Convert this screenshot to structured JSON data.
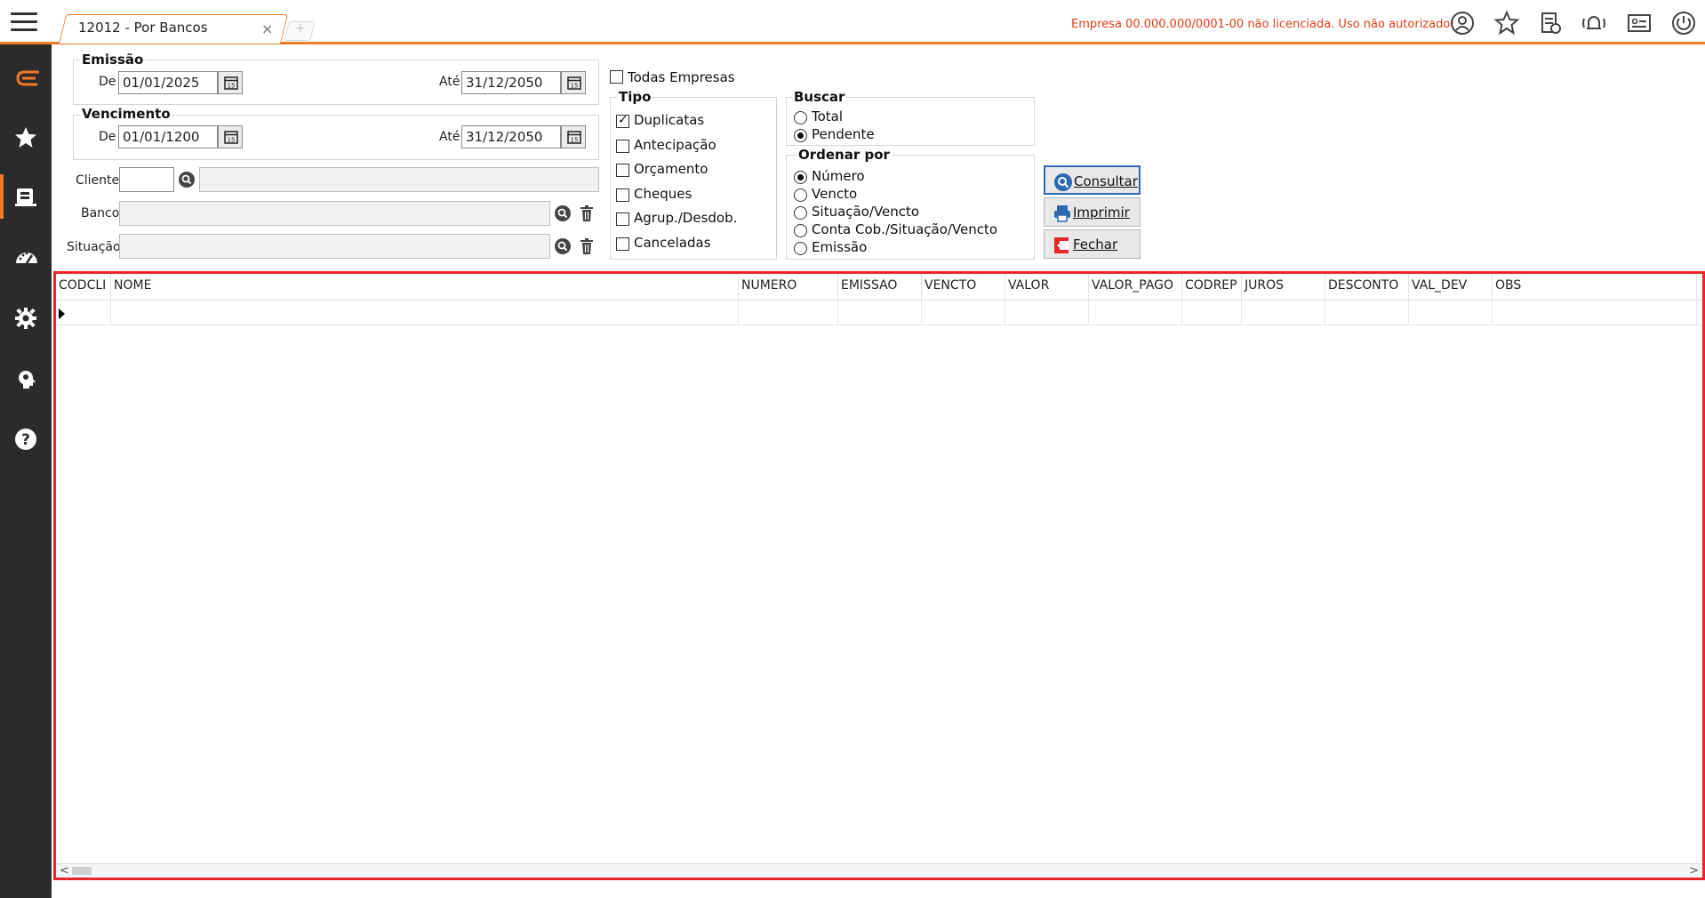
{
  "tab": {
    "label": "12012 - Por Bancos",
    "close": "×",
    "new": "+"
  },
  "license_warning": "Empresa 00.000.000/0001-00 não licenciada. Uso não autorizado!",
  "icons": {
    "top": [
      "user-icon",
      "star-icon",
      "report-icon",
      "notification-icon",
      "id-card-icon",
      "power-icon"
    ],
    "sidebar": [
      "logo-icon",
      "star-icon",
      "reports-icon",
      "dashboard-icon",
      "settings-icon",
      "brain-gear-icon",
      "help-icon"
    ]
  },
  "colors": {
    "accent": "#f07a28",
    "sidebar": "#2b2b2b",
    "warning": "#e23c17",
    "grid_border": "#e5262b",
    "focus": "#2c6bb2"
  },
  "emissao": {
    "title": "Emissão",
    "de_label": "De",
    "de_value": "01/01/2025",
    "ate_label": "Até",
    "ate_value": "31/12/2050"
  },
  "vencimento": {
    "title": "Vencimento",
    "de_label": "De",
    "de_value": "01/01/1200",
    "ate_label": "Até",
    "ate_value": "31/12/2050"
  },
  "cliente": {
    "label": "Cliente",
    "code": "",
    "name": ""
  },
  "banco": {
    "label": "Banco",
    "value": ""
  },
  "situacao": {
    "label": "Situação",
    "value": ""
  },
  "todas_empresas": {
    "label": "Todas Empresas",
    "checked": false
  },
  "tipo": {
    "title": "Tipo",
    "items": [
      {
        "label": "Duplicatas",
        "checked": true
      },
      {
        "label": "Antecipação",
        "checked": false
      },
      {
        "label": "Orçamento",
        "checked": false
      },
      {
        "label": "Cheques",
        "checked": false
      },
      {
        "label": "Agrup./Desdob.",
        "checked": false
      },
      {
        "label": "Canceladas",
        "checked": false
      }
    ]
  },
  "buscar": {
    "title": "Buscar",
    "items": [
      {
        "label": "Total",
        "checked": false
      },
      {
        "label": "Pendente",
        "checked": true
      }
    ]
  },
  "ordenar": {
    "title": "Ordenar por",
    "items": [
      {
        "label": "Número",
        "checked": true
      },
      {
        "label": "Vencto",
        "checked": false
      },
      {
        "label": "Situação/Vencto",
        "checked": false
      },
      {
        "label": "Conta Cob./Situação/Vencto",
        "checked": false
      },
      {
        "label": "Emissão",
        "checked": false
      }
    ]
  },
  "buttons": {
    "consultar": "Consultar",
    "imprimir": "Imprimir",
    "fechar": "Fechar"
  },
  "grid": {
    "columns": [
      "CODCLI",
      "NOME",
      "NUMERO",
      "EMISSAO",
      "VENCTO",
      "VALOR",
      "VALOR_PAGO",
      "CODREP",
      "JUROS",
      "DESCONTO",
      "VAL_DEV",
      "OBS"
    ],
    "rows": []
  }
}
